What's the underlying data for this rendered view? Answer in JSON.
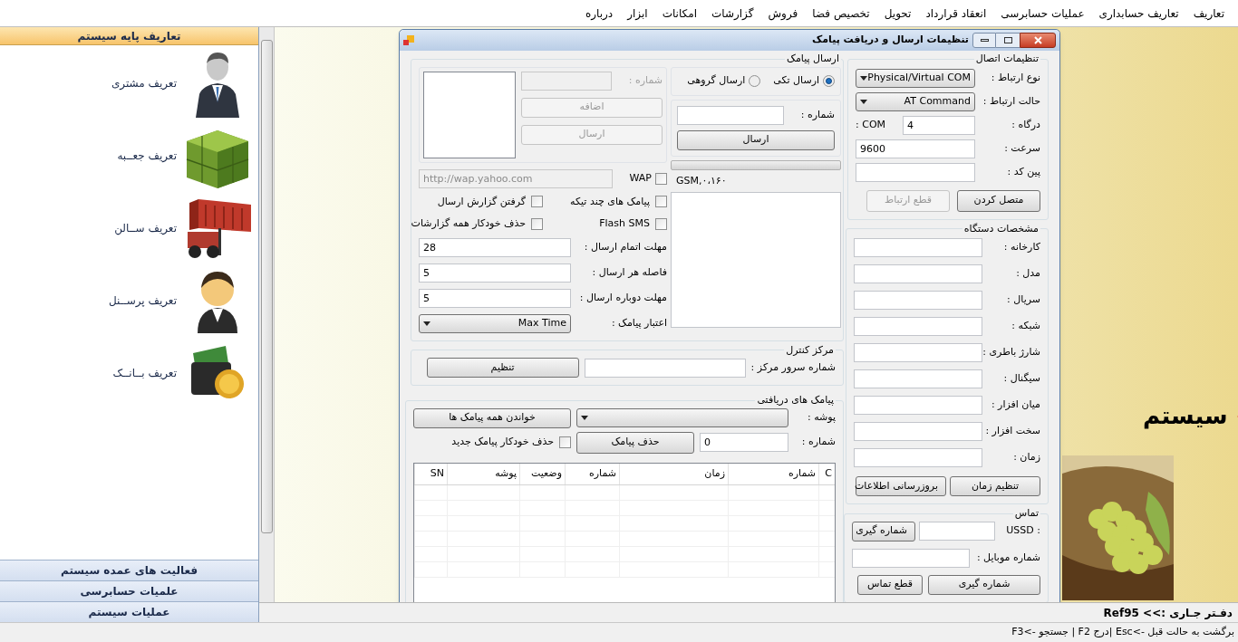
{
  "menu": [
    {
      "label": "تعاریف"
    },
    {
      "label": "تعاریف حسابداری"
    },
    {
      "label": "عملیات حسابرسی"
    },
    {
      "label": "انعقاد قرارداد"
    },
    {
      "label": "تحویل"
    },
    {
      "label": "تخصیص فضا"
    },
    {
      "label": "فروش"
    },
    {
      "label": "گزارشات"
    },
    {
      "label": "امکانات"
    },
    {
      "label": "ابزار"
    },
    {
      "label": "درباره"
    }
  ],
  "sidebar": {
    "header": "تعاریف پایه سیستم",
    "items": [
      {
        "label": "تعریف مشتری"
      },
      {
        "label": "تعریف جعــبه"
      },
      {
        "label": "تعریف ســالن"
      },
      {
        "label": "تعریف پرســنل"
      },
      {
        "label": "تعریف بــانــک"
      }
    ],
    "sections": [
      {
        "label": "فعالیت های عمده سیستم"
      },
      {
        "label": "علمیات حسابرسی"
      },
      {
        "label": "عملیات سیستم"
      }
    ]
  },
  "background": {
    "headline": "سیستم"
  },
  "dialog": {
    "title": "تنظیمات ارسال و دریافت پیامک",
    "connection": {
      "title": "تنظیمات اتصال",
      "rows": [
        {
          "label": "نوع ارتباط :",
          "kind": "select",
          "value": "Physical/Virtual COM"
        },
        {
          "label": "حالت ارتباط :",
          "kind": "select",
          "value": "AT Command"
        },
        {
          "label": "درگاه :",
          "kind": "port",
          "prefix": "COM :",
          "value": "4"
        },
        {
          "label": "سرعت :",
          "kind": "text",
          "value": "9600"
        },
        {
          "label": "پین کد :",
          "kind": "text"
        }
      ],
      "buttons": [
        {
          "label": "متصل کردن",
          "disabled": false
        },
        {
          "label": "قطع ارتباط",
          "disabled": true
        }
      ]
    },
    "device": {
      "title": "مشخصات دستگاه",
      "fields": [
        {
          "label": "کارخانه :"
        },
        {
          "label": "مدل :"
        },
        {
          "label": "سریال :"
        },
        {
          "label": "شبکه :"
        },
        {
          "label": "شارژ باطری :"
        },
        {
          "label": "سیگنال :"
        },
        {
          "label": "میان افزار :"
        },
        {
          "label": "سخت افزار :"
        },
        {
          "label": "زمان :"
        }
      ],
      "buttons": [
        {
          "label": "تنظیم زمان",
          "disabled": false
        },
        {
          "label": "بروزرسانی اطلاعات",
          "disabled": false
        }
      ]
    },
    "contact": {
      "title": "تماس",
      "ussd_label": "USSD :",
      "ussd_button": {
        "label": "شماره گیری",
        "disabled": false
      },
      "mobile_label": "شماره موبایل :",
      "buttons": [
        {
          "label": "شماره گیری",
          "disabled": false
        },
        {
          "label": "قطع تماس",
          "disabled": false
        }
      ]
    },
    "send": {
      "title": "ارسال پیامک",
      "modes": [
        {
          "label": "ارسال تکی",
          "selected": true
        },
        {
          "label": "ارسال گروهی",
          "selected": false
        }
      ],
      "number_label": "شماره :",
      "send_button": {
        "label": "ارسال",
        "disabled": false
      },
      "progress": {
        "level": 0
      },
      "modem_info": "GSM,۰،۱۶۰",
      "group_panel": {
        "disabled": true,
        "number_label": "شماره :",
        "buttons": [
          {
            "label": "اضافه",
            "disabled": true
          },
          {
            "label": "ارسال",
            "disabled": true
          }
        ]
      },
      "wap": {
        "label": "WAP",
        "checked": false,
        "url": "http://wap.yahoo.com"
      },
      "options": [
        {
          "label": "پیامک های چند تیکه",
          "checked": false
        },
        {
          "label": "گرفتن گزارش ارسال",
          "checked": false
        },
        {
          "label": "Flash SMS",
          "checked": false
        },
        {
          "label": "حذف خودکار همه گزارشات",
          "checked": false
        }
      ],
      "settings": [
        {
          "label": "مهلت اتمام ارسال :",
          "kind": "text",
          "value": "28"
        },
        {
          "label": "فاصله هر ارسال :",
          "kind": "text",
          "value": "5"
        },
        {
          "label": "مهلت دوباره ارسال :",
          "kind": "text",
          "value": "5"
        },
        {
          "label": "اعتبار پیامک :",
          "kind": "select",
          "value": "Max Time"
        }
      ]
    },
    "control_center": {
      "title": "مرکز کنترل",
      "label": "شماره سرور مرکز :",
      "button": {
        "label": "تنظیم",
        "disabled": false
      }
    },
    "inbox": {
      "title": "پیامک های دریافتی",
      "folder_label": "پوشه :",
      "read_all_button": {
        "label": "خواندن همه پیامک ها",
        "disabled": false
      },
      "number_label": "شماره :",
      "number_value": "0",
      "delete_button": {
        "label": "حذف پیامک",
        "disabled": false
      },
      "auto_delete": {
        "label": "حذف خودکار پیامک جدید",
        "checked": false
      },
      "columns": [
        {
          "label": "C"
        },
        {
          "label": "شماره"
        },
        {
          "label": "زمان"
        },
        {
          "label": "شماره"
        },
        {
          "label": "وضعیت"
        },
        {
          "label": "پوشه"
        },
        {
          "label": "SN"
        }
      ]
    }
  },
  "ref_bar": {
    "text": "دفـتر جـاری :>> Ref95"
  },
  "status_bar": {
    "text": "برگشت به حالت قبل ->Esc |درج F2 | جستجو ->F3"
  }
}
